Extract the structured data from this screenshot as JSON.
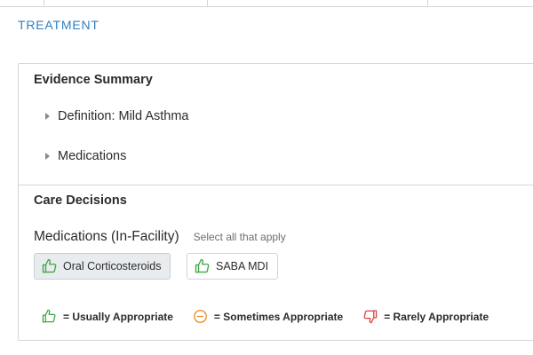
{
  "section": {
    "title": "TREATMENT"
  },
  "evidence_summary": {
    "heading": "Evidence Summary",
    "items": [
      {
        "label": "Definition: Mild Asthma"
      },
      {
        "label": "Medications"
      }
    ]
  },
  "care_decisions": {
    "heading": "Care Decisions",
    "medications_title": "Medications (In-Facility)",
    "hint": "Select all that apply",
    "options": [
      {
        "label": "Oral Corticosteroids",
        "icon": "thumbs-up-icon",
        "selected": true
      },
      {
        "label": "SABA MDI",
        "icon": "thumbs-up-icon",
        "selected": false
      }
    ]
  },
  "legend": [
    {
      "icon": "thumbs-up-icon",
      "label": "= Usually Appropriate",
      "color": "#3aa845"
    },
    {
      "icon": "minus-circle-icon",
      "label": "= Sometimes Appropriate",
      "color": "#e8891c"
    },
    {
      "icon": "thumbs-down-icon",
      "label": "= Rarely Appropriate",
      "color": "#d94141"
    }
  ]
}
